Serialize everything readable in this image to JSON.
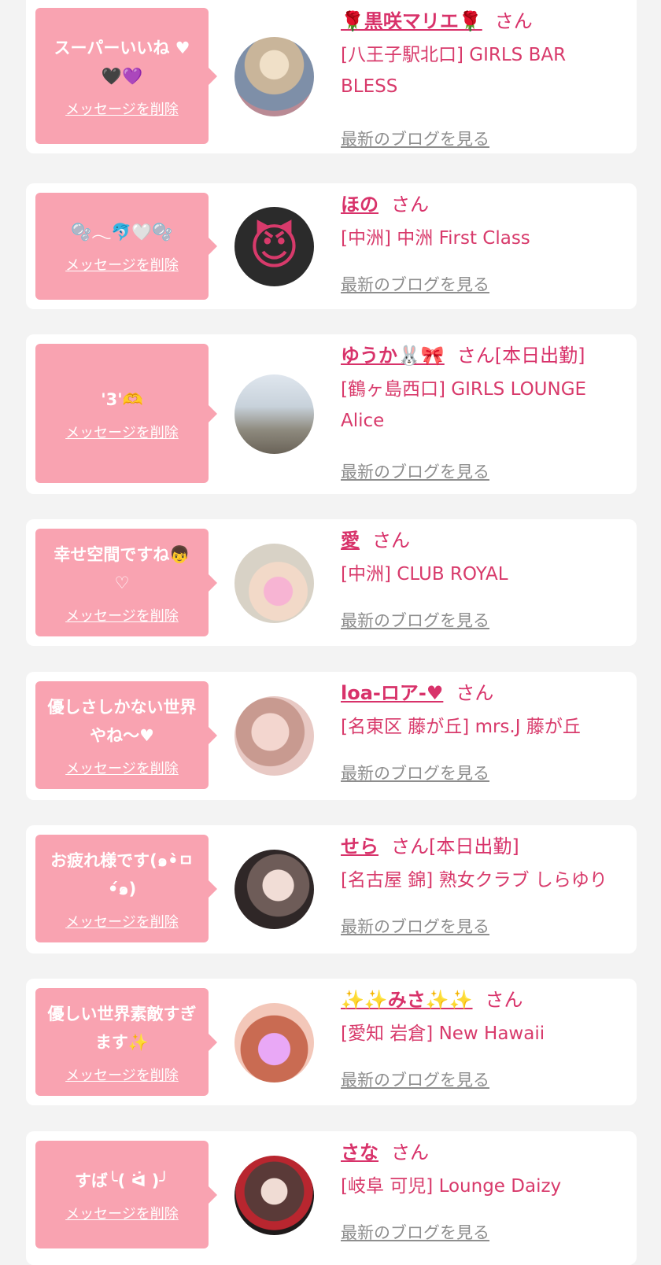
{
  "colors": {
    "page_background": "#f3f3f3",
    "card_background": "#ffffff",
    "bubble_background": "#f9a3b1",
    "name_color": "#d8326a",
    "link_gray": "#8e8e8e"
  },
  "items": [
    {
      "message": "スーパーいいね ♥\n🖤💜",
      "delete_label": "メッセージを削除",
      "name": "🌹黒咲マリエ🌹",
      "honorific": "さん",
      "shop": "[八王子駅北口] GIRLS BAR BLESS",
      "blog_label": "最新のブログを見る",
      "avatar_icon": "profile-photo"
    },
    {
      "message": "🫧𓂃🐬🤍🫧",
      "delete_label": "メッセージを削除",
      "name": "ほの",
      "honorific": "さん",
      "shop": "[中洲] 中洲 First Class",
      "blog_label": "最新のブログを見る",
      "avatar_icon": "smiling-devil-emoji"
    },
    {
      "message": "'3'🫶",
      "delete_label": "メッセージを削除",
      "name": "ゆうか🐰🎀",
      "honorific": "さん[本日出勤]",
      "shop": "[鶴ヶ島西口] GIRLS LOUNGE Alice",
      "blog_label": "最新のブログを見る",
      "avatar_icon": "profile-photo"
    },
    {
      "message": "幸せ空間ですね👦\n♡",
      "delete_label": "メッセージを削除",
      "name": "愛",
      "honorific": "さん",
      "shop": "[中洲] CLUB ROYAL",
      "blog_label": "最新のブログを見る",
      "avatar_icon": "profile-photo"
    },
    {
      "message": "優しさしかない世界やね〜♥",
      "delete_label": "メッセージを削除",
      "name": "loa-ロア-♥",
      "honorific": "さん",
      "shop": "[名東区 藤が丘] mrs.J 藤が丘",
      "blog_label": "最新のブログを見る",
      "avatar_icon": "profile-photo"
    },
    {
      "message": "お疲れ様です(๑•̀ㅁ•́๑)",
      "delete_label": "メッセージを削除",
      "name": "せら",
      "honorific": "さん[本日出勤]",
      "shop": "[名古屋 錦] 熟女クラブ しらゆり",
      "blog_label": "最新のブログを見る",
      "avatar_icon": "profile-photo"
    },
    {
      "message": "優しい世界素敵すぎます✨",
      "delete_label": "メッセージを削除",
      "name": "✨✨みさ✨✨",
      "honorific": "さん",
      "shop": "[愛知 岩倉] New Hawaii",
      "blog_label": "最新のブログを見る",
      "avatar_icon": "profile-photo"
    },
    {
      "message": "すば╰( ᐛ )╯",
      "delete_label": "メッセージを削除",
      "name": "さな",
      "honorific": "さん",
      "shop": "[岐阜 可児] Lounge Daizy",
      "blog_label": "最新のブログを見る",
      "avatar_icon": "profile-photo"
    }
  ]
}
